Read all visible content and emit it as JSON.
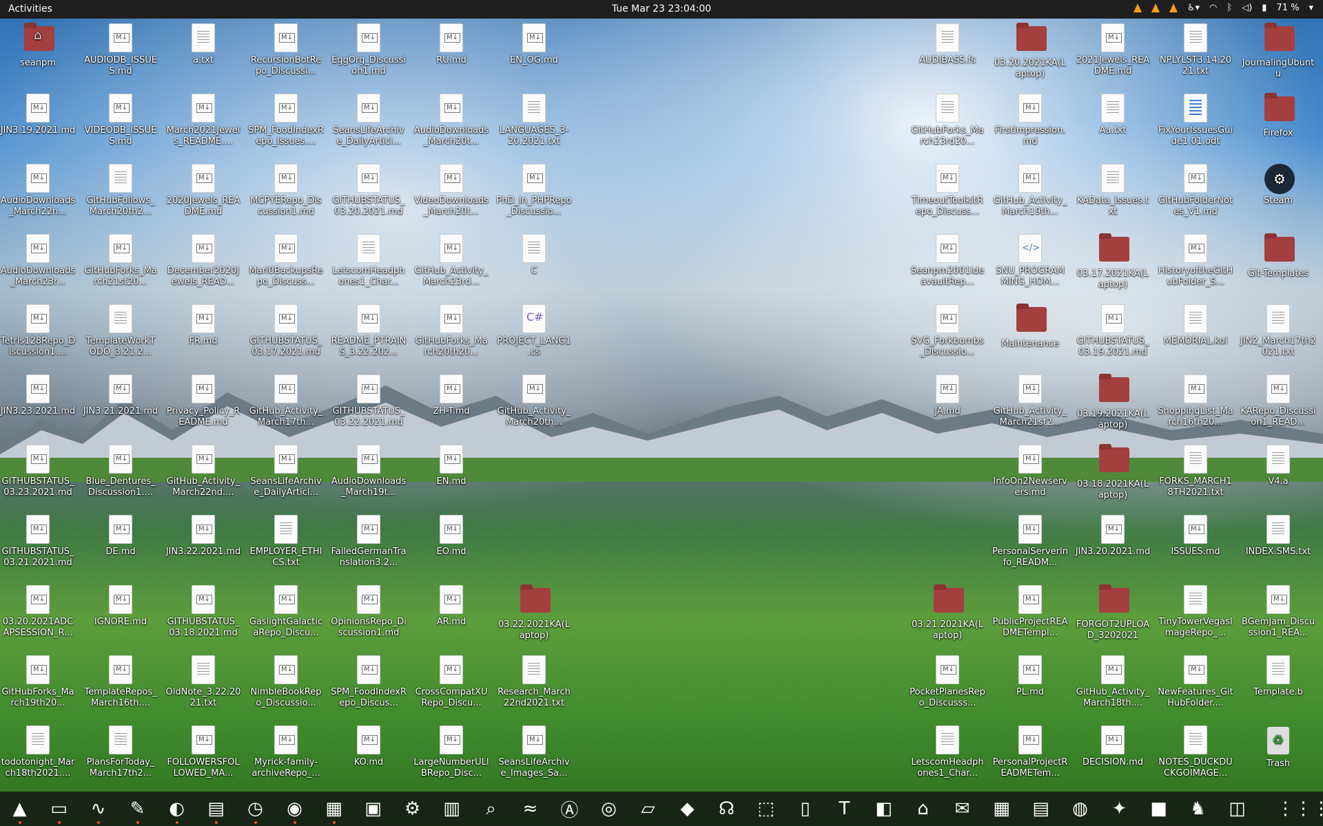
{
  "topbar": {
    "activities": "Activities",
    "clock": "Tue Mar 23  23:04:00",
    "battery": "71 %"
  },
  "colors": {
    "topbar": "#1e1e1e",
    "folder": "#a43f3f",
    "dock": "#141414"
  },
  "icons": [
    {
      "label": "seanpm",
      "kind": "home"
    },
    {
      "label": "AUDIODB_ISSUES.md",
      "kind": "md"
    },
    {
      "label": "a.txt",
      "kind": "txt"
    },
    {
      "label": "RecursionBotRepo_Discussi...",
      "kind": "md"
    },
    {
      "label": "EggOrg_Discussion1.md",
      "kind": "md"
    },
    {
      "label": "RU.md",
      "kind": "md"
    },
    {
      "label": "EN_OG.md",
      "kind": "md"
    },
    {
      "label": "JIN3.19.2021.md",
      "kind": "md"
    },
    {
      "label": "VIDEODB_ISSUES.md",
      "kind": "md"
    },
    {
      "label": "March2021Jewels_README....",
      "kind": "md"
    },
    {
      "label": "SPM_FoodIndexRepo_Issues....",
      "kind": "md"
    },
    {
      "label": "SeansLifeArchive_DailyArticl...",
      "kind": "md"
    },
    {
      "label": "AudioDownloads_March20t...",
      "kind": "md"
    },
    {
      "label": "LANGUAGES_3-20.2021.txt",
      "kind": "txt"
    },
    {
      "label": "AudioDownloads_March22n...",
      "kind": "md"
    },
    {
      "label": "GitHubFollows_March20th2...",
      "kind": "txt"
    },
    {
      "label": "2020Jewels_README.md",
      "kind": "md"
    },
    {
      "label": "MCPYERepo_Discussion1.md",
      "kind": "md"
    },
    {
      "label": "GITHUBSTATUS_03.20.2021.md",
      "kind": "md"
    },
    {
      "label": "VideoDownloads_March20t...",
      "kind": "md"
    },
    {
      "label": "PhD_In_PHPRepo_Discussio...",
      "kind": "md"
    },
    {
      "label": "AudioDownloads_March23r...",
      "kind": "md"
    },
    {
      "label": "GitHubForks_March21st20...",
      "kind": "md"
    },
    {
      "label": "December2020Jewels_READ...",
      "kind": "md"
    },
    {
      "label": "Mari0BackupsRepo_Discuss...",
      "kind": "md"
    },
    {
      "label": "LetscomHeadphones1_Char...",
      "kind": "txt"
    },
    {
      "label": "GitHub_Activity_March23rd...",
      "kind": "md"
    },
    {
      "label": "C",
      "kind": "txt"
    },
    {
      "label": "Tetris128Repo_Discussion1....",
      "kind": "md"
    },
    {
      "label": "TemplateWorkTODO_3.21.2...",
      "kind": "txt"
    },
    {
      "label": "FR.md",
      "kind": "md"
    },
    {
      "label": "GITHUBSTATUS_03.17.2021.md",
      "kind": "md"
    },
    {
      "label": "README_PTRAINS_3.22.202...",
      "kind": "md"
    },
    {
      "label": "GitHubForks_March20th20...",
      "kind": "md"
    },
    {
      "label": "PROJECT_LANG1.cs",
      "kind": "cs"
    },
    {
      "label": "JIN3.23.2021.md",
      "kind": "md"
    },
    {
      "label": "JIN3.21.2021.md",
      "kind": "md"
    },
    {
      "label": "Privacy_Policy_README.md",
      "kind": "md"
    },
    {
      "label": "GitHub_Activity_March17th...",
      "kind": "md"
    },
    {
      "label": "GITHUBSTATUS_03.22.2021.md",
      "kind": "md"
    },
    {
      "label": "ZH-T.md",
      "kind": "md"
    },
    {
      "label": "GitHub_Activity_March20th...",
      "kind": "md"
    },
    {
      "label": "GITHUBSTATUS_03.23.2021.md",
      "kind": "md"
    },
    {
      "label": "Blue_Dentures_Discussion1....",
      "kind": "md"
    },
    {
      "label": "GitHub_Activity_March22nd....",
      "kind": "md"
    },
    {
      "label": "SeansLifeArchive_DailyArticl...",
      "kind": "md"
    },
    {
      "label": "AudioDownloads_March19t...",
      "kind": "md"
    },
    {
      "label": "EN.md",
      "kind": "md"
    },
    {
      "label": "GITHUBSTATUS_03.21.2021.md",
      "kind": "md"
    },
    {
      "label": "DE.md",
      "kind": "md"
    },
    {
      "label": "JIN3.22.2021.md",
      "kind": "md"
    },
    {
      "label": "EMPLOYER_ETHICS.txt",
      "kind": "txt"
    },
    {
      "label": "FailedGermanTranslation3.2...",
      "kind": "md"
    },
    {
      "label": "EO.md",
      "kind": "md"
    },
    {
      "label": "03.20.2021ADCAPSESSION_R...",
      "kind": "md"
    },
    {
      "label": "IGNORE.md",
      "kind": "md"
    },
    {
      "label": "GITHUBSTATUS_03.18.2021.md",
      "kind": "md"
    },
    {
      "label": "GaslightGalacticaRepo_Discu...",
      "kind": "md"
    },
    {
      "label": "OpinionsRepo_Discussion1.md",
      "kind": "md"
    },
    {
      "label": "AR.md",
      "kind": "md"
    },
    {
      "label": "03.22.2021KA(Laptop)",
      "kind": "folder"
    },
    {
      "label": "GitHubForks_March19th20...",
      "kind": "md"
    },
    {
      "label": "TemplateRepos_March16th....",
      "kind": "md"
    },
    {
      "label": "OldNote_3.22.2021.txt",
      "kind": "txt"
    },
    {
      "label": "NimbleBookRepo_Discussio...",
      "kind": "md"
    },
    {
      "label": "SPM_FoodIndexRepo_Discus...",
      "kind": "md"
    },
    {
      "label": "CrossCompatXURepo_Discu...",
      "kind": "md"
    },
    {
      "label": "Research_March22nd2021.txt",
      "kind": "txt"
    },
    {
      "label": "todotonight_March18th2021....",
      "kind": "txt"
    },
    {
      "label": "PlansForToday_March17th2...",
      "kind": "txt"
    },
    {
      "label": "FOLLOWERSFOLLOWED_MA...",
      "kind": "md"
    },
    {
      "label": "Myrick-family-archiveRepo_...",
      "kind": "md"
    },
    {
      "label": "KO.md",
      "kind": "md"
    },
    {
      "label": "LargeNumberULIBRepo_Disc...",
      "kind": "md"
    },
    {
      "label": "SeansLifeArchive_Images_Sa...",
      "kind": "md"
    },
    {
      "label": "AUDIBASS.fs",
      "kind": "txt"
    },
    {
      "label": "03.20.2021KA(Laptop)",
      "kind": "folder"
    },
    {
      "label": "2021Jewels_README.md",
      "kind": "md"
    },
    {
      "label": "NPLYLST3.14.2021.txt",
      "kind": "txt"
    },
    {
      "label": "JournalingUbuntu",
      "kind": "folder"
    },
    {
      "label": "GitHubForks_March23rd20...",
      "kind": "txt"
    },
    {
      "label": "FirstImpression.md",
      "kind": "md"
    },
    {
      "label": "Aa.txt",
      "kind": "txt"
    },
    {
      "label": "FixYourIssuesGuide1.01.odt",
      "kind": "odt"
    },
    {
      "label": "Firefox",
      "kind": "folder"
    },
    {
      "label": "TimeoutToolkitRepo_Discuss...",
      "kind": "md"
    },
    {
      "label": "GitHub_Activity_March19th...",
      "kind": "md"
    },
    {
      "label": "KAData_Issues.txt",
      "kind": "txt"
    },
    {
      "label": "GitHubFolderNotes_V1.md",
      "kind": "md"
    },
    {
      "label": "Steam",
      "kind": "steam"
    },
    {
      "label": "Seanpm2001ideavaultRep...",
      "kind": "md"
    },
    {
      "label": "SNU_PROGRAMMING_HOM...",
      "kind": "html"
    },
    {
      "label": "03.17.2021KA(Laptop)",
      "kind": "folder"
    },
    {
      "label": "HistoryoftheGitHubFolder_S...",
      "kind": "md"
    },
    {
      "label": "Git-Templates",
      "kind": "folder"
    },
    {
      "label": "SVG_Forkbombs_Discussio...",
      "kind": "md"
    },
    {
      "label": "Maintenance",
      "kind": "folder"
    },
    {
      "label": "GITHUBSTATUS_03.19.2021.md",
      "kind": "md"
    },
    {
      "label": "MEMORIAL.koi",
      "kind": "txt"
    },
    {
      "label": "JIN2_March17th2021.txt",
      "kind": "txt"
    },
    {
      "label": "JA.md",
      "kind": "md"
    },
    {
      "label": "GitHub_Activity_March21st2...",
      "kind": "md"
    },
    {
      "label": "03.19.2021KA(Laptop)",
      "kind": "folder"
    },
    {
      "label": "ShoppingList_March16th20...",
      "kind": "md"
    },
    {
      "label": "KARepo_Discussion1_READ...",
      "kind": "md"
    },
    {
      "label": "InfoOn2Newservers.md",
      "kind": "md"
    },
    {
      "label": "03.18.2021KA(Laptop)",
      "kind": "folder"
    },
    {
      "label": "FORKS_MARCH18TH2021.txt",
      "kind": "txt"
    },
    {
      "label": "V4.a",
      "kind": "txt"
    },
    {
      "label": "PersonalServerInfo_READM...",
      "kind": "md"
    },
    {
      "label": "JIN3.20.2021.md",
      "kind": "md"
    },
    {
      "label": "ISSUES.md",
      "kind": "md"
    },
    {
      "label": "INDEX.SMS.txt",
      "kind": "txt"
    },
    {
      "label": "03.21.2021KA(Laptop)",
      "kind": "folder"
    },
    {
      "label": "PublicProjectREADMETempl...",
      "kind": "md"
    },
    {
      "label": "FORGOT2UPLOAD_3202021",
      "kind": "folder"
    },
    {
      "label": "TinyTowerVegasImageRepo_...",
      "kind": "txt"
    },
    {
      "label": "BGemJam_Discussion1_REA...",
      "kind": "md"
    },
    {
      "label": "PocketPlanesRepo_Discusss...",
      "kind": "md"
    },
    {
      "label": "PL.md",
      "kind": "md"
    },
    {
      "label": "GitHub_Activity_March18th....",
      "kind": "md"
    },
    {
      "label": "NewFeatures_GitHubFolder....",
      "kind": "md"
    },
    {
      "label": "Template.b",
      "kind": "txt"
    },
    {
      "label": "LetscomHeadphones1_Char...",
      "kind": "txt"
    },
    {
      "label": "PersonalProjectREADMETem...",
      "kind": "md"
    },
    {
      "label": "DECISION.md",
      "kind": "md"
    },
    {
      "label": "NOTES_DUCKDUCKGOIMAGE...",
      "kind": "txt"
    },
    {
      "label": "Trash",
      "kind": "trash"
    }
  ],
  "dock": [
    {
      "name": "vlc",
      "glyph": "▲"
    },
    {
      "name": "terminal",
      "glyph": "▭"
    },
    {
      "name": "system-monitor",
      "glyph": "∿"
    },
    {
      "name": "text-editor",
      "glyph": "✎"
    },
    {
      "name": "color-picker",
      "glyph": "◐"
    },
    {
      "name": "files",
      "glyph": "▤"
    },
    {
      "name": "clock",
      "glyph": "◷"
    },
    {
      "name": "firefox",
      "glyph": "◉"
    },
    {
      "name": "notes",
      "glyph": "▦"
    },
    {
      "name": "calculator",
      "glyph": "▣"
    },
    {
      "name": "settings",
      "glyph": "⚙"
    },
    {
      "name": "document-viewer",
      "glyph": "▥"
    },
    {
      "name": "search",
      "glyph": "⌕"
    },
    {
      "name": "audio",
      "glyph": "≈"
    },
    {
      "name": "software",
      "glyph": "Ⓐ"
    },
    {
      "name": "obs",
      "glyph": "◎"
    },
    {
      "name": "virtualbox",
      "glyph": "▱"
    },
    {
      "name": "inkscape",
      "glyph": "◆"
    },
    {
      "name": "headphones",
      "glyph": "☊"
    },
    {
      "name": "screenshot",
      "glyph": "⬚"
    },
    {
      "name": "doc",
      "glyph": "▯"
    },
    {
      "name": "typora",
      "glyph": "T"
    },
    {
      "name": "tweaks",
      "glyph": "◧"
    },
    {
      "name": "store",
      "glyph": "⌂"
    },
    {
      "name": "image-editor",
      "glyph": "✉"
    },
    {
      "name": "spreadsheet",
      "glyph": "▦"
    },
    {
      "name": "impress",
      "glyph": "▤"
    },
    {
      "name": "blender",
      "glyph": "◍"
    },
    {
      "name": "gimp",
      "glyph": "✦"
    },
    {
      "name": "minecraft",
      "glyph": "■"
    },
    {
      "name": "mario",
      "glyph": "♞"
    },
    {
      "name": "editor",
      "glyph": "◫"
    },
    {
      "name": "show-apps",
      "glyph": "⋮⋮⋮"
    }
  ]
}
